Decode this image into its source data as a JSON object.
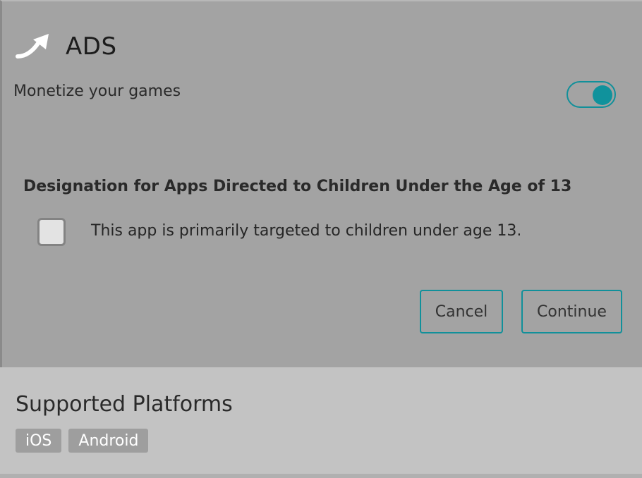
{
  "ads": {
    "icon": "arrow-up-right-curved-icon",
    "title": "ADS",
    "monetize_label": "Monetize your games",
    "monetize_enabled": true,
    "toggle_color": "#10929c"
  },
  "designation": {
    "heading": "Designation for Apps Directed to Children Under the Age of 13",
    "checkbox_label": "This app is primarily targeted to children under age 13.",
    "checked": false
  },
  "actions": {
    "cancel_label": "Cancel",
    "continue_label": "Continue"
  },
  "platforms": {
    "title": "Supported Platforms",
    "items": [
      "iOS",
      "Android"
    ]
  }
}
